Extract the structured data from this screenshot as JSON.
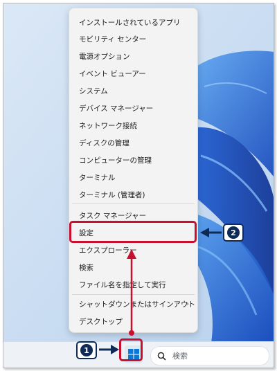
{
  "context_menu": {
    "items": [
      {
        "label": "インストールされているアプリ"
      },
      {
        "label": "モビリティ センター"
      },
      {
        "label": "電源オプション"
      },
      {
        "label": "イベント ビューアー"
      },
      {
        "label": "システム"
      },
      {
        "label": "デバイス マネージャー"
      },
      {
        "label": "ネットワーク接続"
      },
      {
        "label": "ディスクの管理"
      },
      {
        "label": "コンピューターの管理"
      },
      {
        "label": "ターミナル"
      },
      {
        "label": "ターミナル (管理者)"
      },
      {
        "label": "タスク マネージャー"
      },
      {
        "label": "設定"
      },
      {
        "label": "エクスプローラー"
      },
      {
        "label": "検索"
      },
      {
        "label": "ファイル名を指定して実行"
      },
      {
        "label": "シャットダウンまたはサインアウト",
        "submenu_indicator": "›"
      },
      {
        "label": "デスクトップ"
      }
    ],
    "highlighted_item": "設定"
  },
  "taskbar": {
    "start_button_icon": "windows-logo-icon",
    "search": {
      "icon": "search-icon",
      "placeholder": "検索"
    }
  },
  "annotations": {
    "step1_label": "1",
    "step2_label": "2",
    "highlight_color": "#c8102e",
    "badge_color": "#0e2a55"
  }
}
